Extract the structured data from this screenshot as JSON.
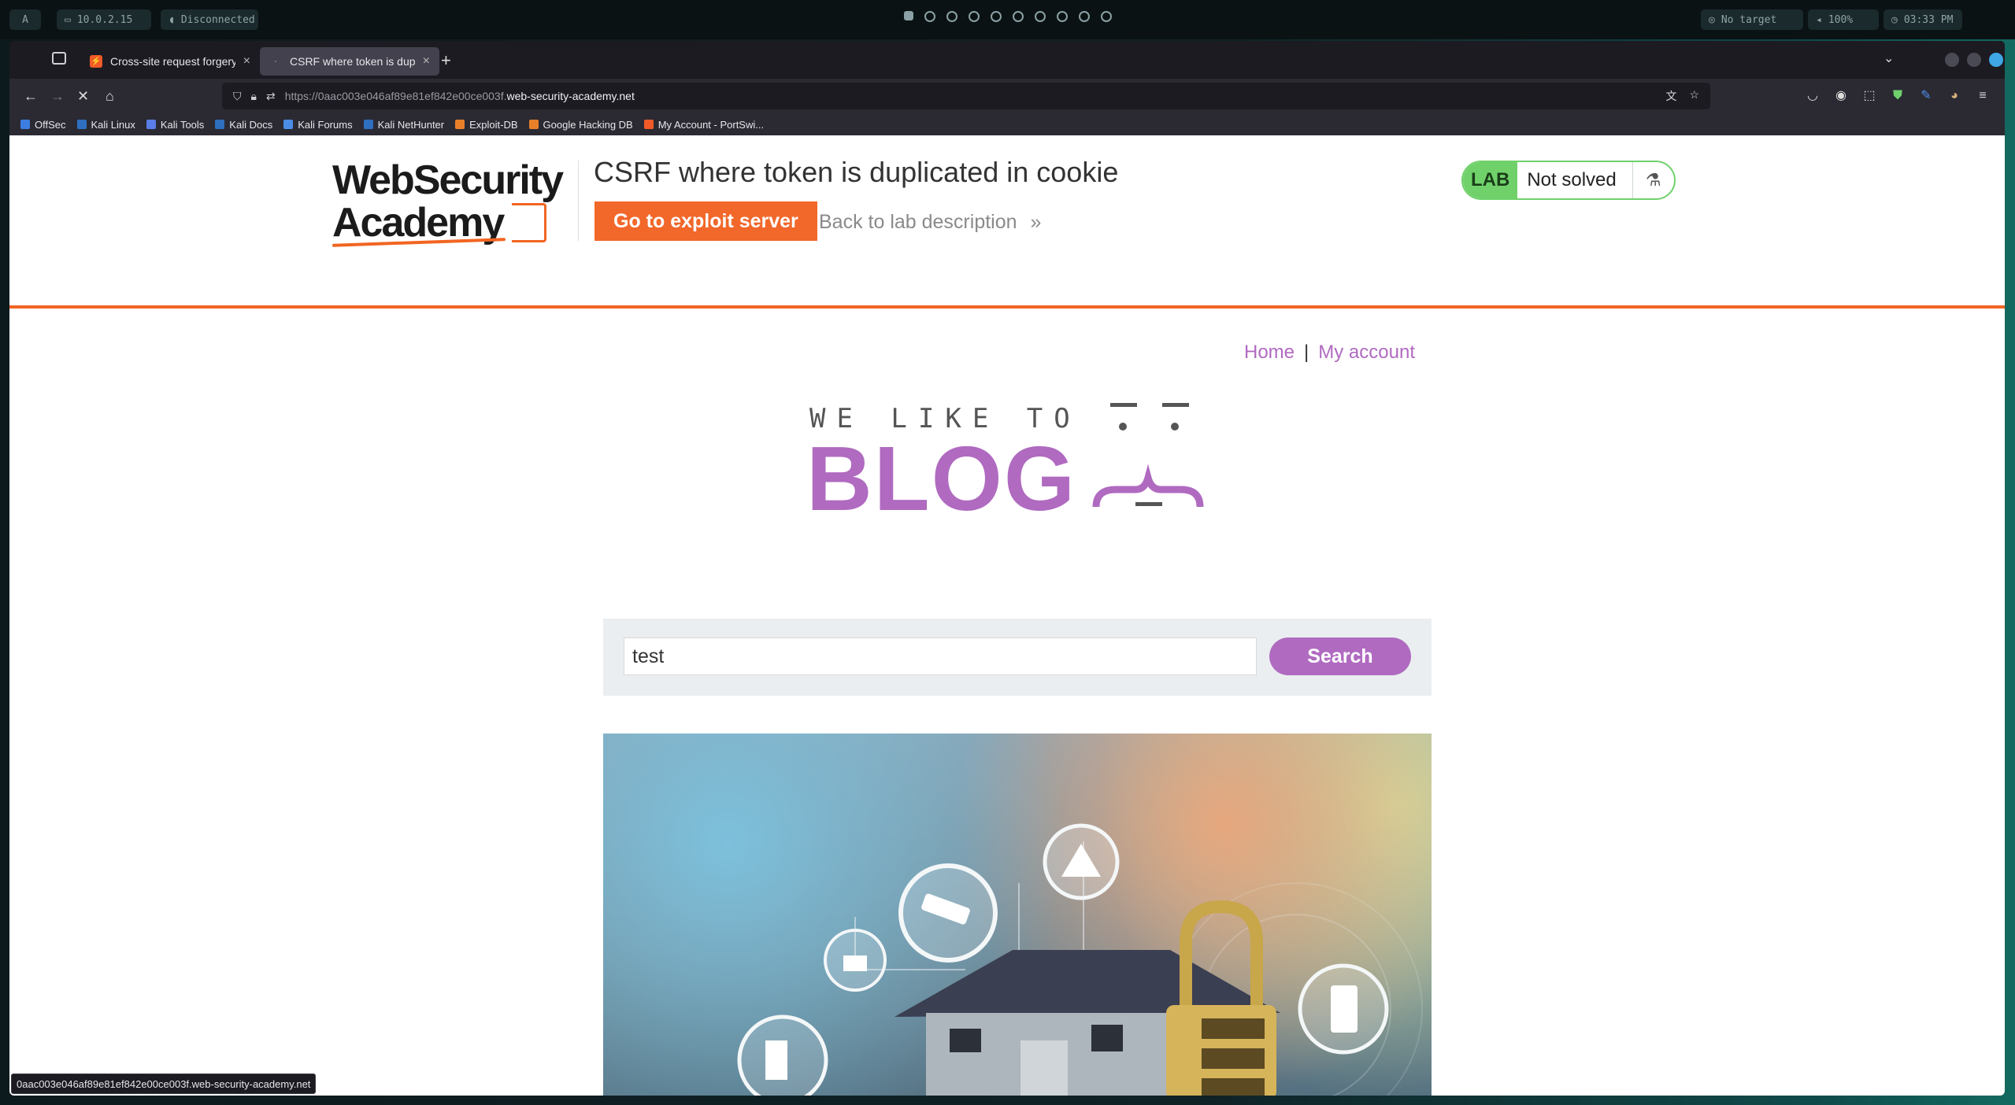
{
  "system_bar": {
    "launcher": "A",
    "ip": "10.0.2.15",
    "vpn": "Disconnected",
    "target": "No target",
    "volume": "100%",
    "clock": "03:33 PM"
  },
  "tabs": [
    {
      "title": "Cross-site request forgery",
      "active": false
    },
    {
      "title": "CSRF where token is duplic",
      "active": true
    }
  ],
  "address_bar": {
    "url_prefix": "https://0aac003e046af89e81ef842e00ce003f.",
    "url_host": "web-security-academy.net"
  },
  "bookmarks": [
    "OffSec",
    "Kali Linux",
    "Kali Tools",
    "Kali Docs",
    "Kali Forums",
    "Kali NetHunter",
    "Exploit-DB",
    "Google Hacking DB",
    "My Account - PortSwi..."
  ],
  "lab_header": {
    "logo_line1": "WebSecurity",
    "logo_line2": "Academy",
    "title": "CSRF where token is duplicated in cookie",
    "exploit_button": "Go to exploit server",
    "back_link": "Back to lab description",
    "lab_badge": "LAB",
    "lab_status": "Not solved"
  },
  "site_nav": {
    "home": "Home",
    "separator": "|",
    "account": "My account"
  },
  "hero": {
    "tagline": "WE LIKE TO",
    "word": "BLOG"
  },
  "search": {
    "value": "test",
    "button": "Search"
  },
  "status_url": "0aac003e046af89e81ef842e00ce003f.web-security-academy.net",
  "colors": {
    "accent": "#f26522",
    "blog_purple": "#b06ac0",
    "lab_green": "#70d16b"
  }
}
